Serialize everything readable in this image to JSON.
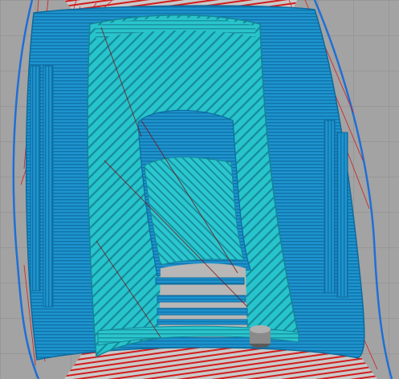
{
  "viewer": {
    "mode": "layer-preview",
    "colors": {
      "build_plate": "#a3a3a3",
      "grid_line": "#8b8b8b",
      "outer_wall": "#1e94cf",
      "outer_wall_dark": "#0f6fa3",
      "inner_wall": "#22b6cf",
      "infill": "#27c4cc",
      "infill_line": "#1a8e9f",
      "travel_move": "#d21c1c",
      "skirt": "#1f6fd6",
      "nozzle": "#7e7e7e"
    },
    "icons": {
      "nozzle": "nozzle-marker-icon"
    }
  }
}
